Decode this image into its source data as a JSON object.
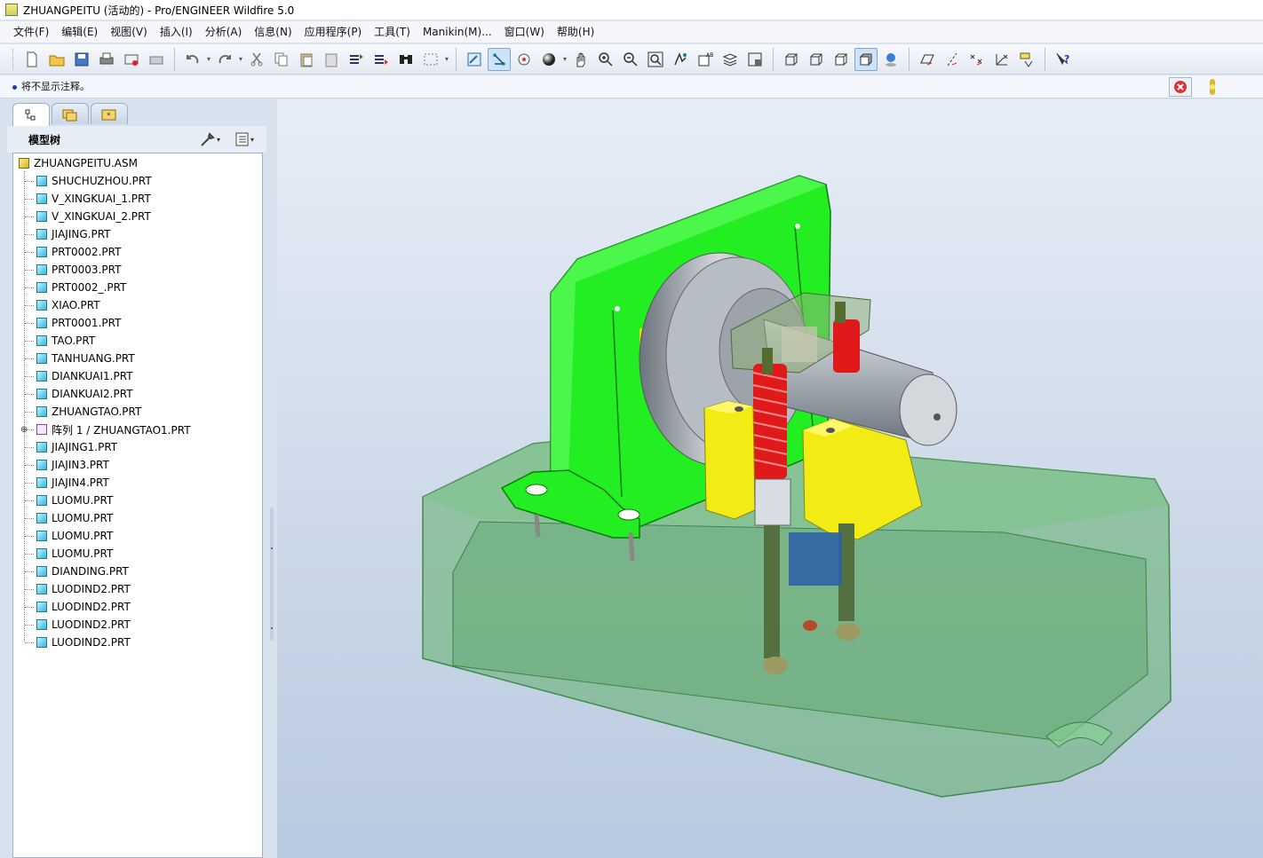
{
  "window": {
    "title": "ZHUANGPEITU (活动的) - Pro/ENGINEER Wildfire 5.0"
  },
  "menu": [
    "文件(F)",
    "编辑(E)",
    "视图(V)",
    "插入(I)",
    "分析(A)",
    "信息(N)",
    "应用程序(P)",
    "工具(T)",
    "Manikin(M)...",
    "窗口(W)",
    "帮助(H)"
  ],
  "message": "将不显示注释。",
  "model_tree": {
    "title": "模型树",
    "root": "ZHUANGPEITU.ASM",
    "items": [
      "SHUCHUZHOU.PRT",
      "V_XINGKUAI_1.PRT",
      "V_XINGKUAI_2.PRT",
      "JIAJING.PRT",
      "PRT0002.PRT",
      "PRT0003.PRT",
      "PRT0002_.PRT",
      "XIAO.PRT",
      "PRT0001.PRT",
      "TAO.PRT",
      "TANHUANG.PRT",
      "DIANKUAI1.PRT",
      "DIANKUAI2.PRT",
      "ZHUANGTAO.PRT",
      "阵列 1 / ZHUANGTAO1.PRT",
      "JIAJING1.PRT",
      "JIAJIN3.PRT",
      "JIAJIN4.PRT",
      "LUOMU.PRT",
      "LUOMU.PRT",
      "LUOMU.PRT",
      "LUOMU.PRT",
      "DIANDING.PRT",
      "LUODIND2.PRT",
      "LUODIND2.PRT",
      "LUODIND2.PRT",
      "LUODIND2.PRT"
    ],
    "expandable_index": 14
  },
  "colors": {
    "bracket": "#22ee22",
    "base": "#5fae6a",
    "spring": "#e01a1a",
    "blocks": "#f2ec14",
    "shaft": "#b6bcc4"
  }
}
